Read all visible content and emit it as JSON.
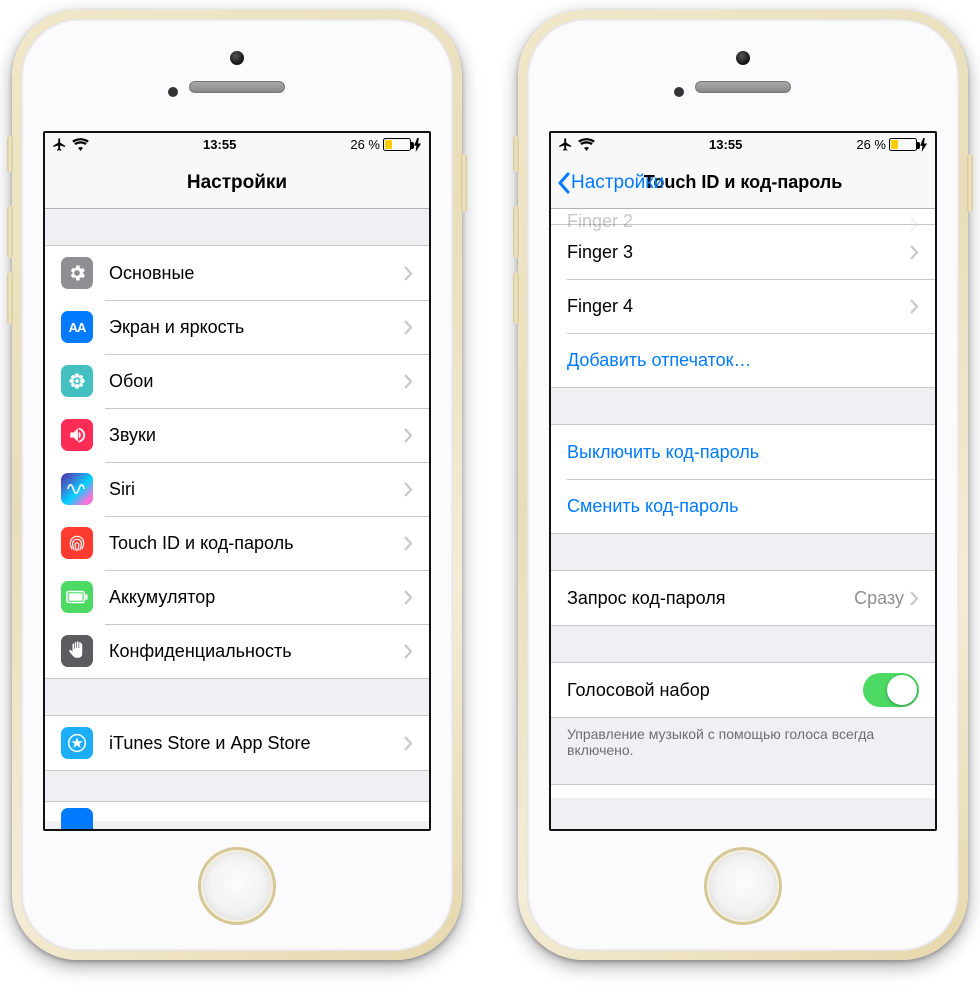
{
  "status": {
    "time": "13:55",
    "battery_pct": "26 %"
  },
  "left": {
    "title": "Настройки",
    "items": [
      {
        "id": "general",
        "label": "Основные"
      },
      {
        "id": "display",
        "label": "Экран и яркость"
      },
      {
        "id": "wallpaper",
        "label": "Обои"
      },
      {
        "id": "sounds",
        "label": "Звуки"
      },
      {
        "id": "siri",
        "label": "Siri"
      },
      {
        "id": "touchid",
        "label": "Touch ID и код-пароль"
      },
      {
        "id": "battery",
        "label": "Аккумулятор"
      },
      {
        "id": "privacy",
        "label": "Конфиденциальность"
      }
    ],
    "items2": [
      {
        "id": "itunes",
        "label": "iTunes Store и App Store"
      }
    ]
  },
  "right": {
    "back_label": "Настройки",
    "title": "Touch ID и код-пароль",
    "fingers_partial": "Finger 2",
    "fingers": [
      {
        "label": "Finger 3"
      },
      {
        "label": "Finger 4"
      }
    ],
    "add_fingerprint": "Добавить отпечаток…",
    "turn_off": "Выключить код-пароль",
    "change": "Сменить код-пароль",
    "require_label": "Запрос код-пароля",
    "require_value": "Сразу",
    "voice_dial": "Голосовой набор",
    "voice_dial_on": true,
    "voice_note": "Управление музыкой с помощью голоса всегда включено."
  }
}
